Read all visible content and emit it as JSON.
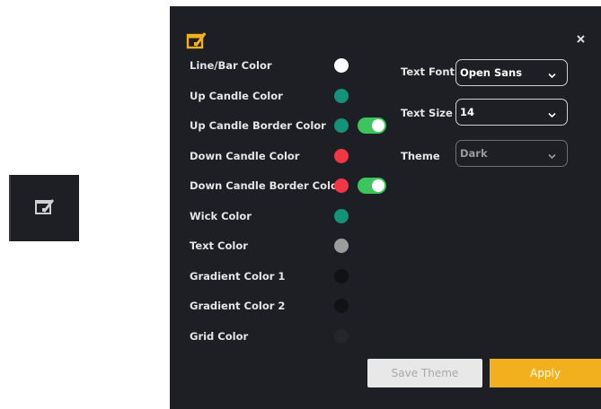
{
  "colors": {
    "panel_bg": "#1e1f24",
    "accent": "#f2b01e",
    "toggle_on": "#3cc55d"
  },
  "color_settings": [
    {
      "label": "Line/Bar Color",
      "color": "#ffffff",
      "toggle": false
    },
    {
      "label": "Up Candle Color",
      "color": "#12937a",
      "toggle": false
    },
    {
      "label": "Up Candle Border Color",
      "color": "#12937a",
      "toggle": true
    },
    {
      "label": "Down Candle Color",
      "color": "#f23645",
      "toggle": false
    },
    {
      "label": "Down Candle Border Color",
      "color": "#f23645",
      "toggle": true
    },
    {
      "label": "Wick Color",
      "color": "#12937a",
      "toggle": false
    },
    {
      "label": "Text Color",
      "color": "#9c9c9c",
      "toggle": false
    },
    {
      "label": "Gradient Color 1",
      "color": "#111214",
      "toggle": false
    },
    {
      "label": "Gradient Color 2",
      "color": "#111214",
      "toggle": false
    },
    {
      "label": "Grid Color",
      "color": "#25262c",
      "toggle": false
    }
  ],
  "font_settings": [
    {
      "label": "Text Font",
      "value": "Open Sans",
      "enabled": true
    },
    {
      "label": "Text Size",
      "value": "14",
      "enabled": true
    },
    {
      "label": "Theme",
      "value": "Dark",
      "enabled": false
    }
  ],
  "buttons": {
    "save_theme": "Save Theme",
    "apply": "Apply"
  },
  "icons": {
    "toolbar": "chart-settings-icon",
    "panel": "chart-settings-icon",
    "close": "close-icon",
    "dropdown": "chevron-down-icon"
  }
}
